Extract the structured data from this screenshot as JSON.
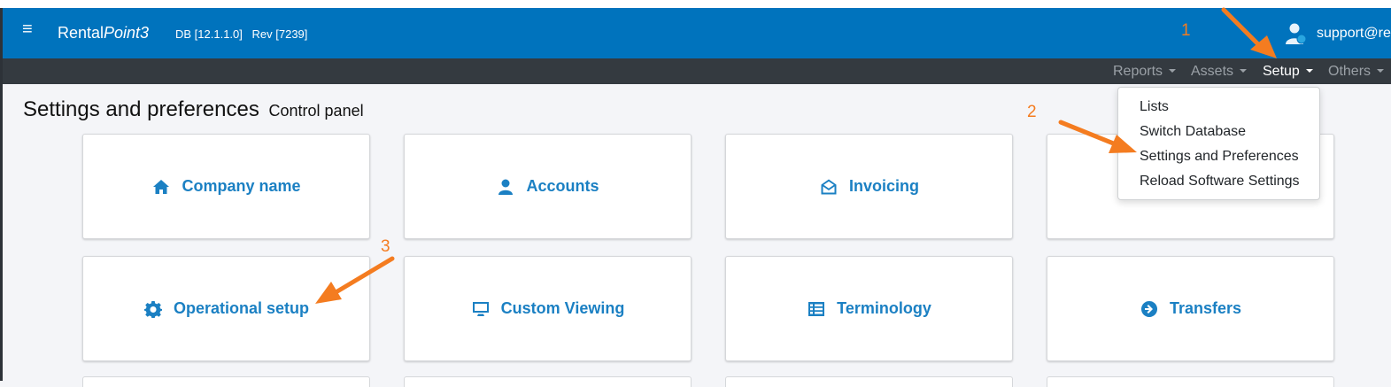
{
  "header": {
    "brand_part1": "Rental",
    "brand_part2": "Point3",
    "db_version": "DB [12.1.1.0]",
    "rev": "Rev [7239]",
    "user": "support@re"
  },
  "nav": {
    "reports": "Reports",
    "assets": "Assets",
    "setup": "Setup",
    "others": "Others"
  },
  "dropdown": {
    "items": [
      "Lists",
      "Switch Database",
      "Settings and Preferences",
      "Reload Software Settings"
    ]
  },
  "page": {
    "title": "Settings and preferences",
    "subtitle": "Control panel"
  },
  "cards": [
    {
      "label": "Company name",
      "icon": "home-icon"
    },
    {
      "label": "Accounts",
      "icon": "user-icon"
    },
    {
      "label": "Invoicing",
      "icon": "envelope-open-icon"
    },
    {
      "label": "",
      "icon": ""
    },
    {
      "label": "Operational setup",
      "icon": "gear-icon"
    },
    {
      "label": "Custom Viewing",
      "icon": "monitor-icon"
    },
    {
      "label": "Terminology",
      "icon": "list-icon"
    },
    {
      "label": "Transfers",
      "icon": "arrow-circle-right-icon"
    }
  ],
  "annotations": {
    "a1": "1",
    "a2": "2",
    "a3": "3",
    "color": "#f47c20"
  },
  "colors": {
    "header_bg": "#0073bd",
    "navbar_bg": "#343a40",
    "card_text": "#1b80c3"
  }
}
